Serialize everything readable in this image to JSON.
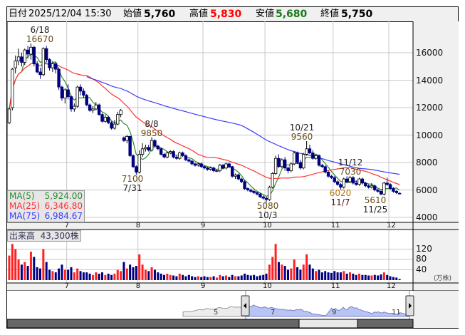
{
  "header": {
    "date_label": "日付",
    "datetime": "2025/12/04 15:30",
    "open_label": "始値",
    "open": "5,760",
    "high_label": "高値",
    "high": "5,830",
    "low_label": "安値",
    "low": "5,680",
    "close_label": "終値",
    "close": "5,750"
  },
  "legend": [
    {
      "name": "MA(5)",
      "value": "5,924.00",
      "color": "#2e8b2e"
    },
    {
      "name": "MA(25)",
      "value": "6,346.80",
      "color": "#ff3030"
    },
    {
      "name": "MA(75)",
      "value": "6,984.67",
      "color": "#3a3aff"
    }
  ],
  "volume_legend": {
    "label": "出来高",
    "value": "43,300株"
  },
  "annotations": [
    {
      "date": "6/18",
      "value": "16670"
    },
    {
      "date": "8/8",
      "value": "9850"
    },
    {
      "date": "7/31",
      "value": "7100"
    },
    {
      "date": "10/21",
      "value": "9560"
    },
    {
      "date": "10/3",
      "value": "5080"
    },
    {
      "date": "11/12",
      "value": "7030"
    },
    {
      "date": "11/7",
      "value": "6020"
    },
    {
      "date": "11/25",
      "value": "5610"
    }
  ],
  "navigator": {
    "labels": [
      "5",
      "7",
      "9",
      "11"
    ]
  },
  "chart_data": {
    "type": "candlestick",
    "price_axis": {
      "ticks": [
        4000,
        6000,
        8000,
        10000,
        12000,
        14000,
        16000
      ],
      "range": [
        3600,
        17500
      ]
    },
    "volume_axis": {
      "ticks": [
        40,
        80,
        120
      ],
      "unit": "(万株)"
    },
    "month_labels": [
      "7",
      "8",
      "9",
      "10",
      "11",
      "12"
    ],
    "month_start_index": [
      19,
      42,
      63,
      83,
      105,
      123
    ],
    "colors": {
      "up": "#ffffff",
      "down": "#000080",
      "vol_up": "#ff2020",
      "vol_down": "#000080"
    },
    "ohlc": [
      [
        10900,
        12000,
        10800,
        11900
      ],
      [
        12000,
        14900,
        11800,
        14800
      ],
      [
        14900,
        15800,
        14500,
        15400
      ],
      [
        15400,
        16300,
        15100,
        15700
      ],
      [
        15700,
        16000,
        15000,
        15300
      ],
      [
        15300,
        16300,
        15100,
        16200
      ],
      [
        16200,
        16500,
        15600,
        15900
      ],
      [
        15900,
        16670,
        15500,
        16400
      ],
      [
        16400,
        16500,
        15000,
        15200
      ],
      [
        15200,
        15400,
        14500,
        14600
      ],
      [
        14600,
        14900,
        14100,
        14400
      ],
      [
        14400,
        16400,
        14300,
        16300
      ],
      [
        16300,
        16500,
        15300,
        15500
      ],
      [
        15500,
        15600,
        14700,
        14900
      ],
      [
        14900,
        15400,
        14600,
        15200
      ],
      [
        15200,
        15300,
        14500,
        14800
      ],
      [
        14800,
        14900,
        13300,
        13500
      ],
      [
        13500,
        13600,
        12500,
        12700
      ],
      [
        12700,
        13400,
        12300,
        13300
      ],
      [
        13300,
        13700,
        12600,
        12800
      ],
      [
        12800,
        12900,
        11700,
        11900
      ],
      [
        11900,
        12300,
        11700,
        12100
      ],
      [
        12100,
        13600,
        12000,
        13500
      ],
      [
        13500,
        13700,
        12900,
        13200
      ],
      [
        13200,
        13400,
        12700,
        12900
      ],
      [
        12900,
        13000,
        12100,
        12200
      ],
      [
        12200,
        12300,
        11700,
        11800
      ],
      [
        11800,
        12100,
        11600,
        11900
      ],
      [
        11900,
        12400,
        11800,
        12200
      ],
      [
        12200,
        12300,
        11400,
        11500
      ],
      [
        11500,
        11600,
        10900,
        11000
      ],
      [
        11000,
        11500,
        10900,
        11300
      ],
      [
        11300,
        11400,
        10800,
        10900
      ],
      [
        10900,
        11000,
        10400,
        10500
      ],
      [
        10500,
        11100,
        10400,
        10800
      ],
      [
        10800,
        11700,
        10700,
        11500
      ],
      [
        11500,
        11900,
        11300,
        11800
      ],
      [
        9800,
        9900,
        9500,
        9600
      ],
      [
        9600,
        10000,
        9400,
        9900
      ],
      [
        9900,
        9950,
        8400,
        8500
      ],
      [
        8500,
        8600,
        7600,
        7700
      ],
      [
        7700,
        7800,
        7100,
        7300
      ],
      [
        7300,
        8900,
        7200,
        8600
      ],
      [
        8600,
        9400,
        8400,
        9000
      ],
      [
        9000,
        9300,
        8800,
        9100
      ],
      [
        9100,
        9300,
        8800,
        8900
      ],
      [
        8900,
        9850,
        8800,
        9600
      ],
      [
        9600,
        9700,
        9100,
        9200
      ],
      [
        9200,
        9300,
        8900,
        9000
      ],
      [
        9000,
        9100,
        8500,
        8600
      ],
      [
        8600,
        8700,
        8300,
        8400
      ],
      [
        8400,
        8800,
        8300,
        8700
      ],
      [
        8700,
        8900,
        8600,
        8800
      ],
      [
        8800,
        8900,
        8300,
        8400
      ],
      [
        8400,
        8500,
        8200,
        8300
      ],
      [
        8300,
        8800,
        8200,
        8700
      ],
      [
        8700,
        8800,
        8400,
        8500
      ],
      [
        8500,
        8600,
        8100,
        8200
      ],
      [
        8200,
        8300,
        8000,
        8100
      ],
      [
        8100,
        8200,
        7800,
        7900
      ],
      [
        7900,
        8000,
        7700,
        7800
      ],
      [
        7800,
        8000,
        7700,
        7900
      ],
      [
        7900,
        8000,
        7600,
        7700
      ],
      [
        7700,
        7800,
        7500,
        7600
      ],
      [
        7600,
        7700,
        7400,
        7500
      ],
      [
        7500,
        7700,
        7400,
        7600
      ],
      [
        7600,
        7700,
        7300,
        7400
      ],
      [
        7400,
        7500,
        7300,
        7400
      ],
      [
        7400,
        7900,
        7300,
        7800
      ],
      [
        7800,
        7900,
        7500,
        7600
      ],
      [
        7600,
        8000,
        7500,
        7900
      ],
      [
        7900,
        8000,
        7600,
        7700
      ],
      [
        7700,
        7750,
        6900,
        7000
      ],
      [
        7000,
        7200,
        6800,
        7100
      ],
      [
        7100,
        7200,
        6700,
        6800
      ],
      [
        6800,
        6900,
        6500,
        6600
      ],
      [
        6600,
        6700,
        6000,
        6100
      ],
      [
        6100,
        6200,
        5900,
        6000
      ],
      [
        6000,
        6100,
        5800,
        5900
      ],
      [
        5900,
        6000,
        5700,
        5800
      ],
      [
        5800,
        5900,
        5600,
        5700
      ],
      [
        5700,
        5800,
        5400,
        5500
      ],
      [
        5500,
        5600,
        5300,
        5400
      ],
      [
        5400,
        5500,
        5080,
        5300
      ],
      [
        5300,
        6300,
        5200,
        6200
      ],
      [
        6200,
        7300,
        6100,
        7200
      ],
      [
        7200,
        8500,
        7100,
        8300
      ],
      [
        8300,
        8600,
        7600,
        7700
      ],
      [
        7700,
        8300,
        7600,
        8200
      ],
      [
        8200,
        8400,
        7400,
        7600
      ],
      [
        7600,
        7700,
        7200,
        7400
      ],
      [
        7400,
        8000,
        7300,
        7900
      ],
      [
        7900,
        8800,
        7800,
        8700
      ],
      [
        8700,
        8800,
        7900,
        8000
      ],
      [
        8000,
        8200,
        7500,
        7600
      ],
      [
        7600,
        8700,
        7500,
        8600
      ],
      [
        8600,
        9560,
        8500,
        9000
      ],
      [
        9000,
        9300,
        8600,
        8700
      ],
      [
        8700,
        8900,
        8200,
        8300
      ],
      [
        8300,
        8600,
        8200,
        8500
      ],
      [
        8500,
        8600,
        7700,
        7800
      ],
      [
        7800,
        7900,
        7600,
        7700
      ],
      [
        7700,
        7800,
        7200,
        7300
      ],
      [
        7300,
        7400,
        6900,
        7000
      ],
      [
        7000,
        7100,
        6800,
        6900
      ],
      [
        6900,
        7000,
        6500,
        6600
      ],
      [
        6600,
        6700,
        6300,
        6400
      ],
      [
        6400,
        6500,
        6020,
        6200
      ],
      [
        6200,
        6900,
        6100,
        6800
      ],
      [
        6800,
        7000,
        6500,
        6600
      ],
      [
        6600,
        7030,
        6500,
        6900
      ],
      [
        6900,
        7000,
        6400,
        6500
      ],
      [
        6500,
        6700,
        6300,
        6400
      ],
      [
        6400,
        6900,
        6300,
        6800
      ],
      [
        6800,
        6900,
        6400,
        6500
      ],
      [
        6500,
        6600,
        6200,
        6300
      ],
      [
        6300,
        6400,
        6100,
        6200
      ],
      [
        6200,
        6500,
        6100,
        6300
      ],
      [
        6300,
        6400,
        5900,
        6000
      ],
      [
        6000,
        6100,
        5800,
        5900
      ],
      [
        5900,
        6000,
        5610,
        5700
      ],
      [
        5700,
        6600,
        5600,
        6500
      ],
      [
        6500,
        6900,
        6300,
        6400
      ],
      [
        6400,
        6500,
        6000,
        6100
      ],
      [
        6100,
        6200,
        5800,
        5900
      ],
      [
        5900,
        6000,
        5700,
        5800
      ],
      [
        5760,
        5830,
        5680,
        5750
      ]
    ],
    "volume": [
      95,
      140,
      120,
      80,
      60,
      70,
      55,
      110,
      90,
      50,
      45,
      120,
      70,
      40,
      35,
      30,
      45,
      60,
      40,
      40,
      50,
      30,
      45,
      35,
      30,
      30,
      25,
      20,
      30,
      25,
      30,
      20,
      25,
      20,
      25,
      40,
      35,
      70,
      45,
      60,
      50,
      55,
      100,
      60,
      40,
      35,
      50,
      40,
      30,
      25,
      20,
      25,
      20,
      18,
      15,
      25,
      20,
      15,
      20,
      15,
      12,
      15,
      12,
      15,
      12,
      12,
      15,
      10,
      20,
      15,
      18,
      12,
      20,
      15,
      15,
      18,
      25,
      20,
      18,
      20,
      15,
      18,
      20,
      25,
      60,
      90,
      140,
      70,
      60,
      55,
      40,
      45,
      80,
      50,
      40,
      60,
      100,
      60,
      45,
      35,
      40,
      30,
      35,
      30,
      28,
      35,
      30,
      30,
      35,
      25,
      30,
      25,
      20,
      25,
      20,
      20,
      18,
      18,
      20,
      18,
      22,
      30,
      20,
      15,
      12,
      10,
      4.33
    ],
    "ma_periods": [
      5,
      25,
      75
    ],
    "navigator_pre_range": [
      6800,
      7000,
      6900,
      7300,
      7800,
      7600,
      8200,
      7900,
      8000,
      8600,
      8300,
      8200,
      9000,
      8700,
      8800,
      8600
    ]
  }
}
